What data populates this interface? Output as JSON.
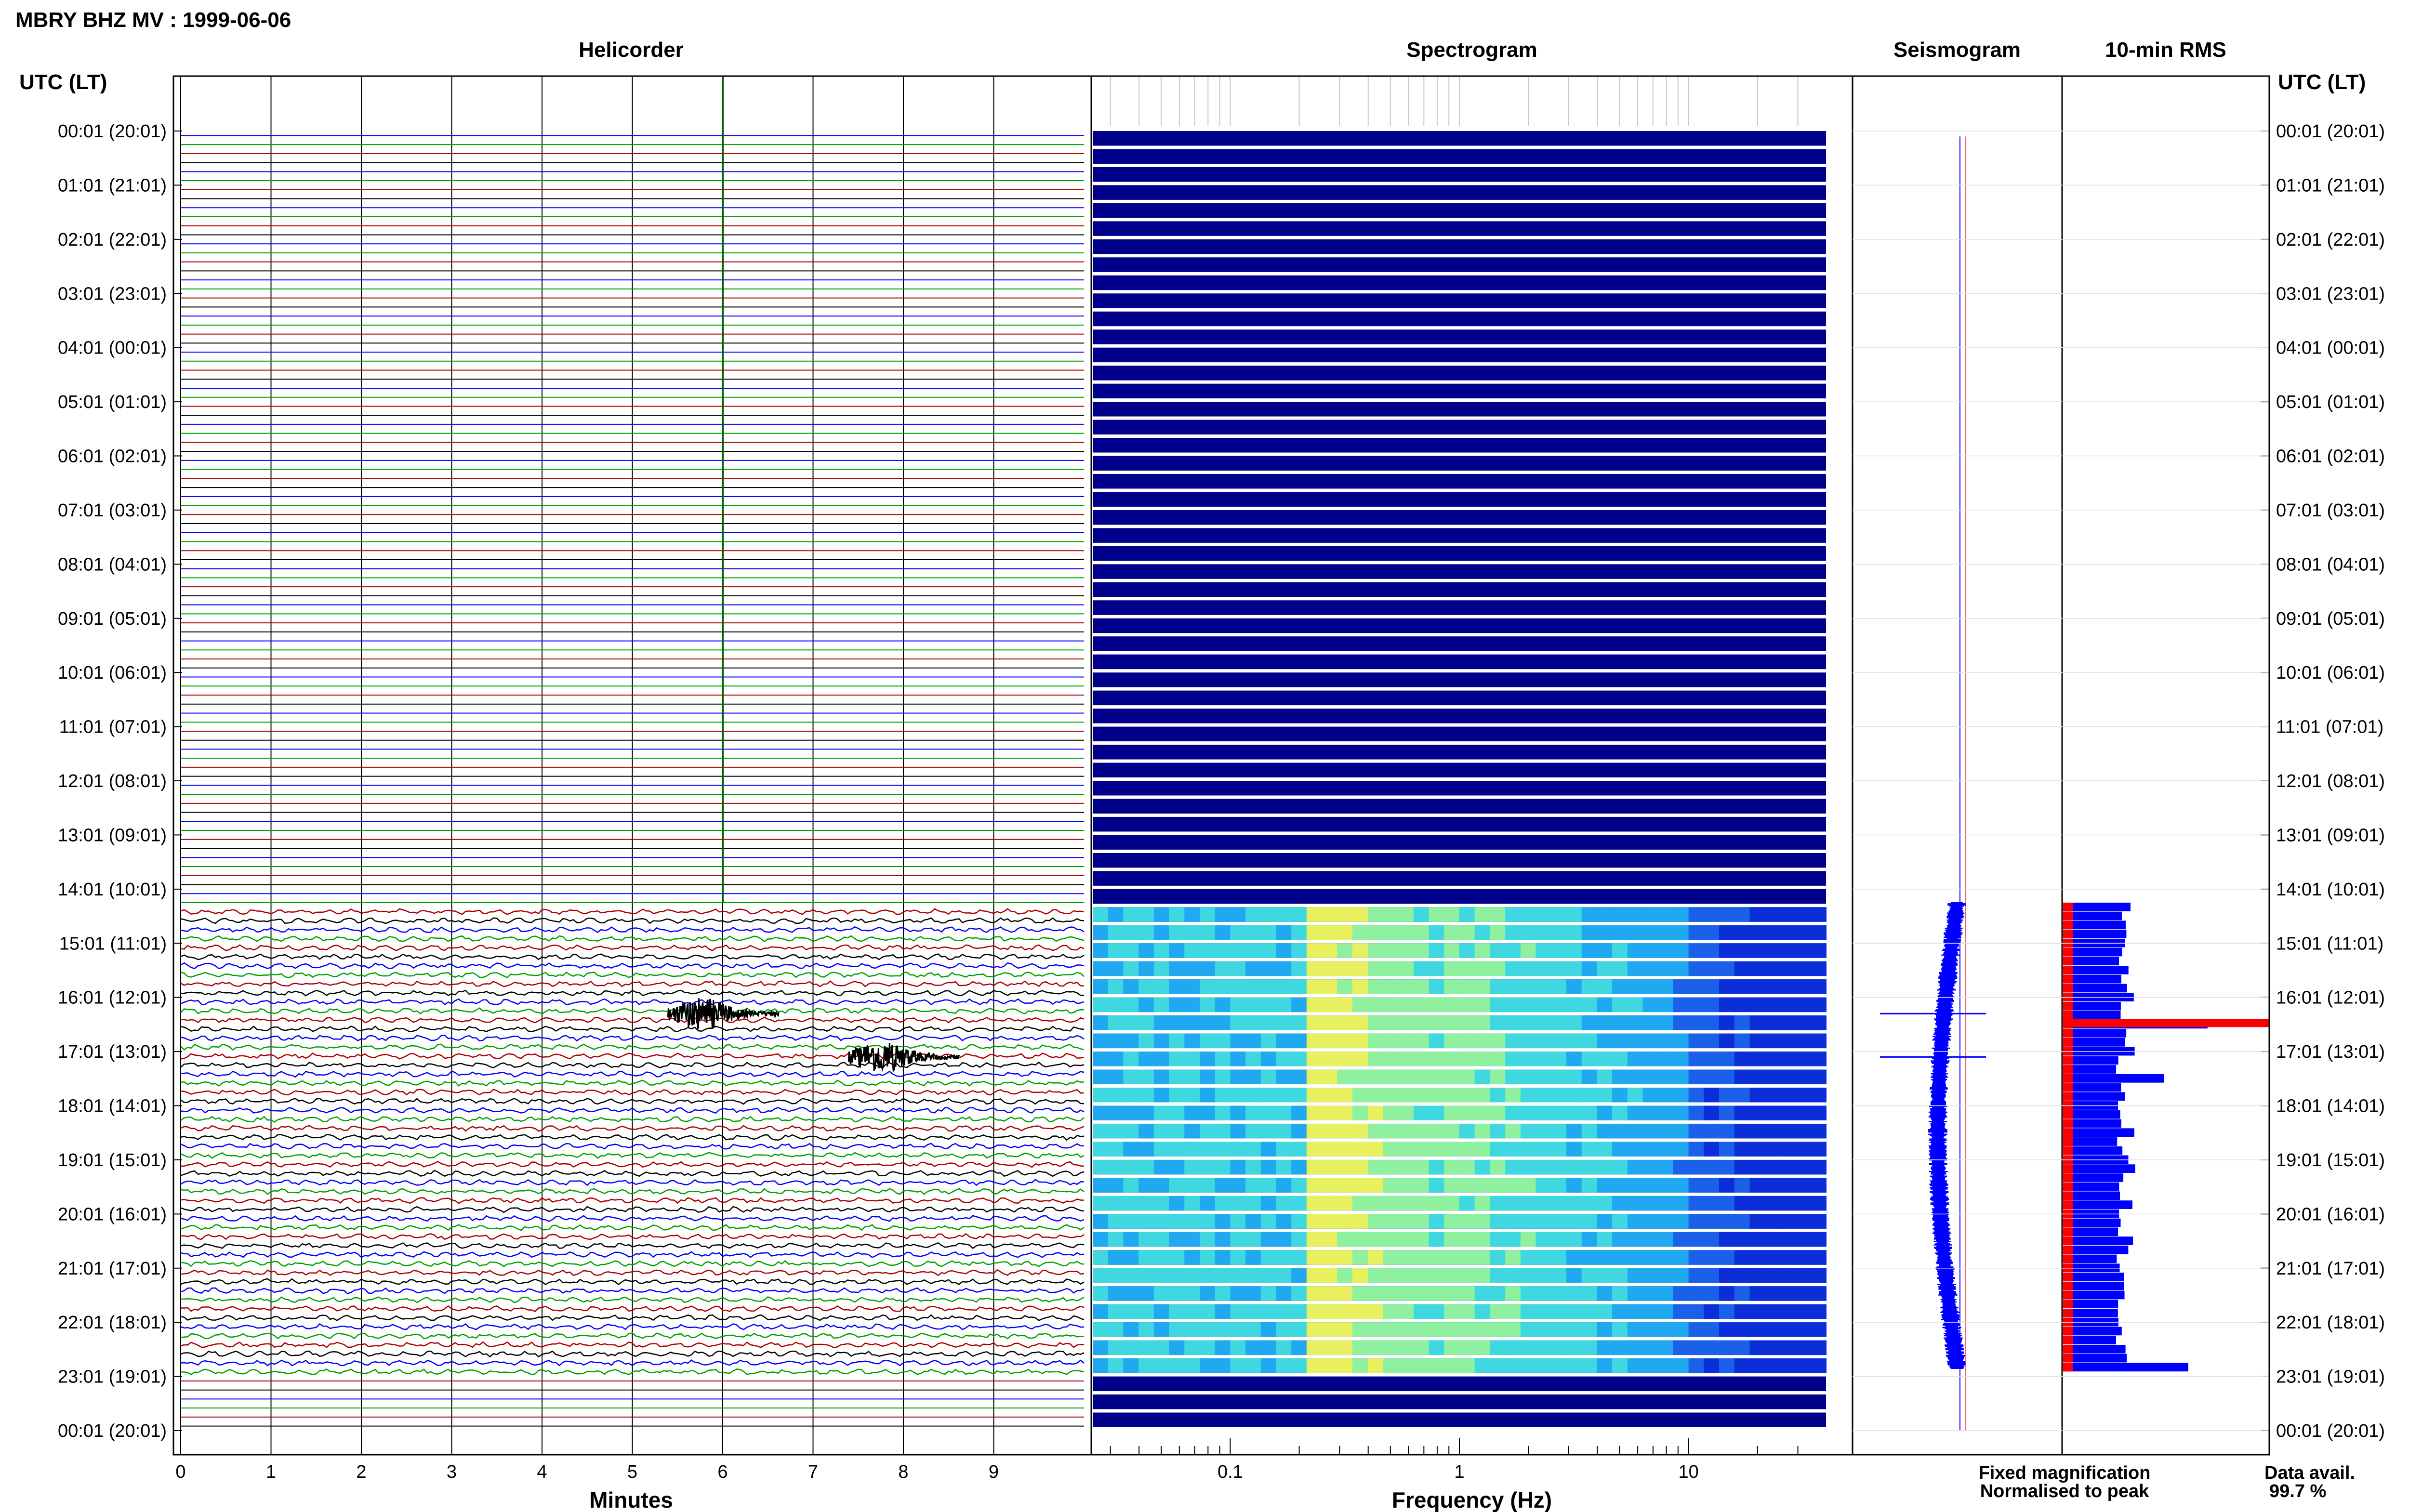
{
  "header": {
    "title": "MBRY BHZ MV : 1999-06-06"
  },
  "panels": {
    "helicorder": "Helicorder",
    "spectrogram": "Spectrogram",
    "seismogram": "Seismogram",
    "rms": "10-min RMS"
  },
  "axes": {
    "left_label": "UTC (LT)",
    "right_label": "UTC (LT)",
    "minutes_label": "Minutes",
    "frequency_label": "Frequency (Hz)"
  },
  "legend": {
    "fixed": "Fixed magnification",
    "normalised": "Normalised to peak",
    "fixed_color": "#0000ff",
    "normalised_color": "#ff0000"
  },
  "availability": {
    "label": "Data avail.",
    "value": "99.7 %"
  },
  "chart_data": {
    "type": "helicorder-spectrogram",
    "time_labels": [
      "00:01 (20:01)",
      "01:01 (21:01)",
      "02:01 (22:01)",
      "03:01 (23:01)",
      "04:01 (00:01)",
      "05:01 (01:01)",
      "06:01 (02:01)",
      "07:01 (03:01)",
      "08:01 (04:01)",
      "09:01 (05:01)",
      "10:01 (06:01)",
      "11:01 (07:01)",
      "12:01 (08:01)",
      "13:01 (09:01)",
      "14:01 (10:01)",
      "15:01 (11:01)",
      "16:01 (12:01)",
      "17:01 (13:01)",
      "18:01 (14:01)",
      "19:01 (15:01)",
      "20:01 (16:01)",
      "21:01 (17:01)",
      "22:01 (18:01)",
      "23:01 (19:01)",
      "00:01 (20:01)"
    ],
    "minutes_ticks": [
      "0",
      "1",
      "2",
      "3",
      "4",
      "5",
      "6",
      "7",
      "8",
      "9"
    ],
    "minutes_range": [
      0,
      10
    ],
    "frequency_ticks": [
      "0.1",
      "1",
      "10"
    ],
    "frequency_range_log10": [
      -1.6,
      1.6
    ],
    "trace_colors": [
      "#0000ff",
      "#00a000",
      "#aa0000",
      "#000000"
    ],
    "data_start_hour": 14.25,
    "data_end_hour": 22.85,
    "events": [
      {
        "hour": 16.3,
        "minute": 5.9
      },
      {
        "hour": 17.1,
        "minute": 7.9
      }
    ],
    "rms_peak_hour": 16.4
  }
}
